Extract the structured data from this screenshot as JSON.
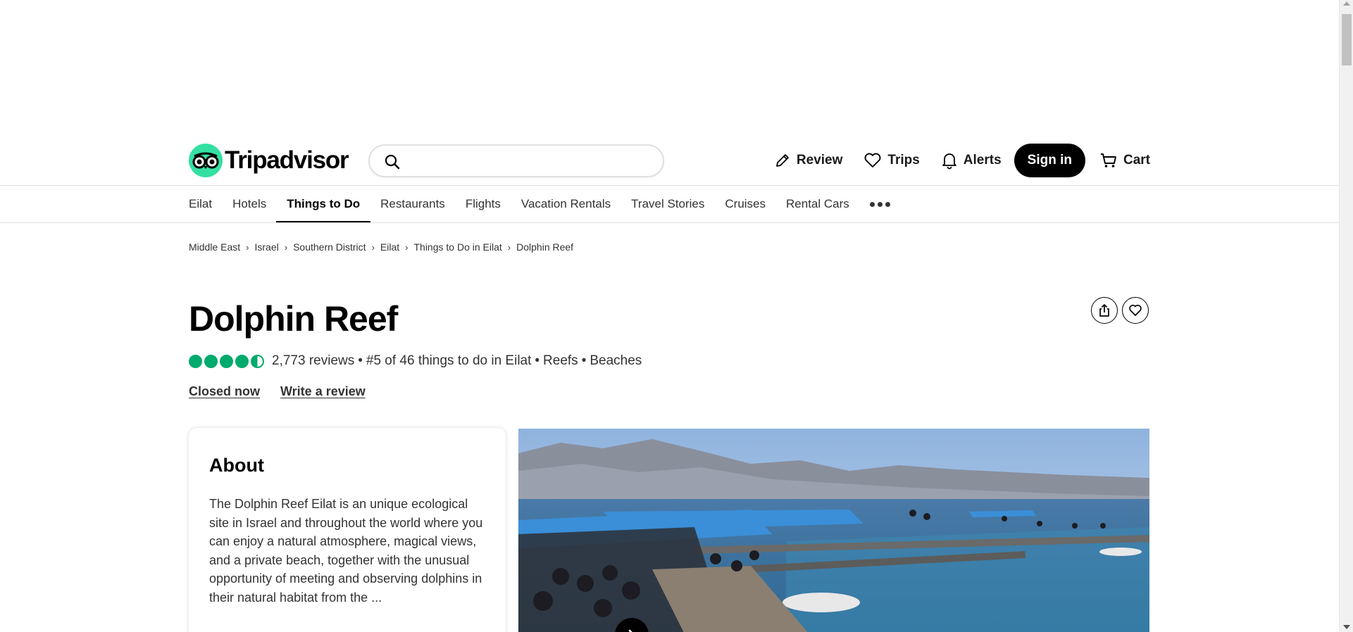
{
  "header": {
    "logo_text": "Tripadvisor",
    "search_placeholder": "",
    "actions": {
      "review": "Review",
      "trips": "Trips",
      "alerts": "Alerts",
      "sign_in": "Sign in",
      "cart": "Cart"
    }
  },
  "nav": {
    "tabs": [
      {
        "label": "Eilat"
      },
      {
        "label": "Hotels"
      },
      {
        "label": "Things to Do",
        "active": true
      },
      {
        "label": "Restaurants"
      },
      {
        "label": "Flights"
      },
      {
        "label": "Vacation Rentals"
      },
      {
        "label": "Travel Stories"
      },
      {
        "label": "Cruises"
      },
      {
        "label": "Rental Cars"
      }
    ]
  },
  "breadcrumb": [
    "Middle East",
    "Israel",
    "Southern District",
    "Eilat",
    "Things to Do in Eilat",
    "Dolphin Reef"
  ],
  "attraction": {
    "title": "Dolphin Reef",
    "rating": 4.5,
    "reviews": "2,773 reviews",
    "bullet": "•",
    "rank": "#5 of 46 things to do in Eilat",
    "categories": [
      "Reefs",
      "Beaches"
    ],
    "status_link": "Closed now",
    "write_review": "Write a review"
  },
  "about": {
    "heading": "About",
    "text": "The Dolphin Reef Eilat is an unique ecological site in Israel and throughout the world where you can enjoy a natural atmosphere, magical views, and a private beach, together with the unusual opportunity of meeting and observing dolphins in their natural habitat from the ..."
  },
  "colors": {
    "brand_green": "#34e0a1",
    "rating_green": "#00aa6c",
    "canopy_blue": "#3a8fd8",
    "sea_blue": "#2f6c9a"
  }
}
